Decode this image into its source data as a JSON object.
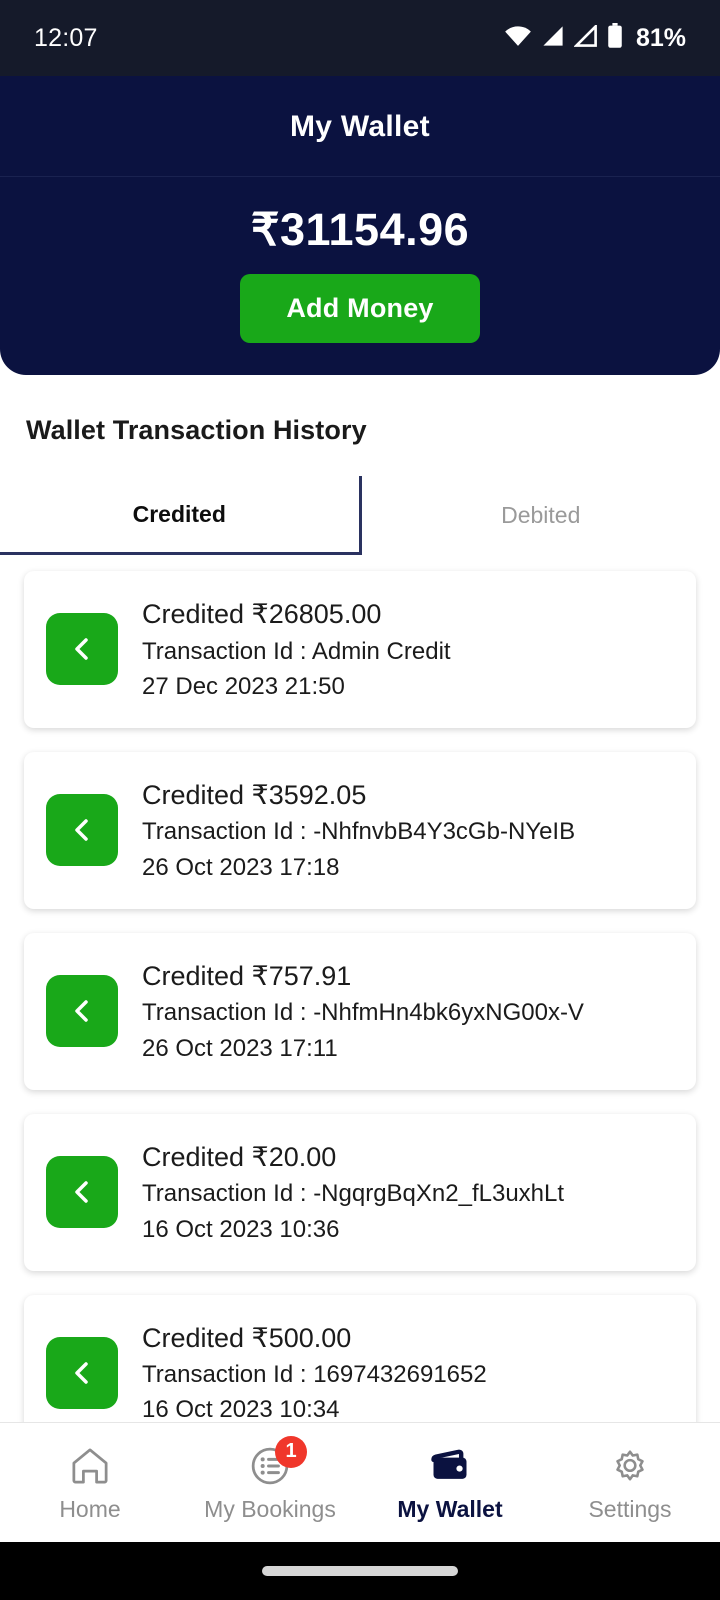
{
  "status_bar": {
    "time": "12:07",
    "battery_percent": "81%",
    "icons": [
      "wifi-icon",
      "signal-icon",
      "signal-icon",
      "battery-icon"
    ]
  },
  "header": {
    "title": "My Wallet",
    "balance": "₹31154.96",
    "add_money_label": "Add Money"
  },
  "history": {
    "section_title": "Wallet Transaction History",
    "tabs": [
      {
        "label": "Credited",
        "active": true
      },
      {
        "label": "Debited",
        "active": false
      }
    ],
    "transactions": [
      {
        "amount": "Credited ₹26805.00",
        "transaction_id": "Transaction Id : Admin Credit",
        "date": "27 Dec 2023 21:50",
        "icon": "chevron-left-icon"
      },
      {
        "amount": "Credited ₹3592.05",
        "transaction_id": "Transaction Id : -NhfnvbB4Y3cGb-NYeIB",
        "date": "26 Oct 2023 17:18",
        "icon": "chevron-left-icon"
      },
      {
        "amount": "Credited ₹757.91",
        "transaction_id": "Transaction Id : -NhfmHn4bk6yxNG00x-V",
        "date": "26 Oct 2023 17:11",
        "icon": "chevron-left-icon"
      },
      {
        "amount": "Credited ₹20.00",
        "transaction_id": "Transaction Id : -NgqrgBqXn2_fL3uxhLt",
        "date": "16 Oct 2023 10:36",
        "icon": "chevron-left-icon"
      },
      {
        "amount": "Credited ₹500.00",
        "transaction_id": "Transaction Id : 1697432691652",
        "date": "16 Oct 2023 10:34",
        "icon": "chevron-left-icon"
      }
    ]
  },
  "bottom_nav": {
    "items": [
      {
        "label": "Home",
        "icon": "home-icon",
        "active": false,
        "badge": ""
      },
      {
        "label": "My Bookings",
        "icon": "list-icon",
        "active": false,
        "badge": "1"
      },
      {
        "label": "My Wallet",
        "icon": "wallet-icon",
        "active": true,
        "badge": ""
      },
      {
        "label": "Settings",
        "icon": "gear-icon",
        "active": false,
        "badge": ""
      }
    ]
  },
  "colors": {
    "navy": "#0b1240",
    "green": "#19a819",
    "badge_red": "#f0372b",
    "status_bar": "#151a2a",
    "inactive_text": "#8e8e8e"
  }
}
